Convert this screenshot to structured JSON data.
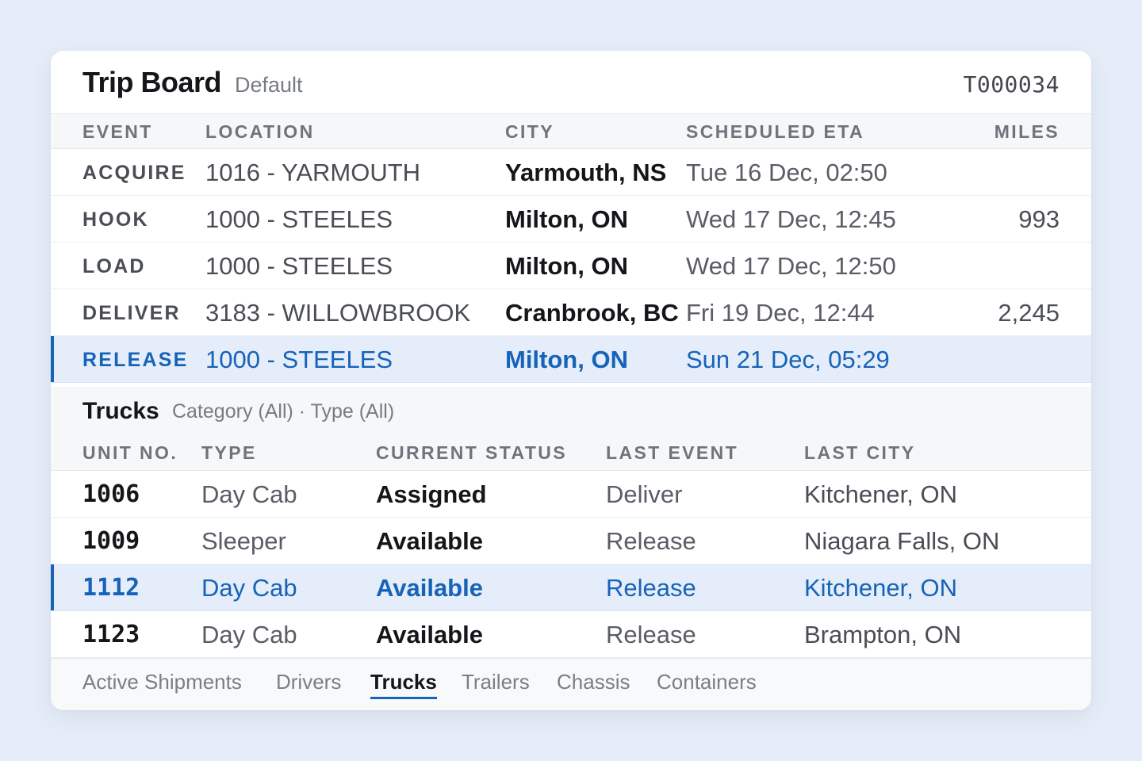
{
  "header": {
    "title": "Trip Board",
    "subtitle": "Default",
    "trip_id": "T000034"
  },
  "trip_table": {
    "columns": [
      "EVENT",
      "LOCATION",
      "CITY",
      "SCHEDULED ETA",
      "MILES"
    ],
    "rows": [
      {
        "event": "ACQUIRE",
        "location": "1016 - YARMOUTH",
        "city": "Yarmouth, NS",
        "eta": "Tue 16 Dec, 02:50",
        "miles": ""
      },
      {
        "event": "HOOK",
        "location": "1000 - STEELES",
        "city": "Milton, ON",
        "eta": "Wed 17 Dec, 12:45",
        "miles": "993"
      },
      {
        "event": "LOAD",
        "location": "1000 - STEELES",
        "city": "Milton, ON",
        "eta": "Wed 17 Dec, 12:50",
        "miles": ""
      },
      {
        "event": "DELIVER",
        "location": "3183 - WILLOWBROOK",
        "city": "Cranbrook, BC",
        "eta": "Fri 19 Dec, 12:44",
        "miles": "2,245"
      },
      {
        "event": "RELEASE",
        "location": "1000 - STEELES",
        "city": "Milton, ON",
        "eta": "Sun 21 Dec, 05:29",
        "miles": ""
      }
    ],
    "selected_row": "RELEASE"
  },
  "trucks": {
    "title": "Trucks",
    "filter": "Category (All) · Type (All)",
    "columns": [
      "UNIT NO.",
      "TYPE",
      "CURRENT STATUS",
      "LAST EVENT",
      "LAST CITY"
    ],
    "rows": [
      {
        "unit": "1006",
        "type": "Day Cab",
        "status": "Assigned",
        "last_event": "Deliver",
        "last_city": "Kitchener, ON"
      },
      {
        "unit": "1009",
        "type": "Sleeper",
        "status": "Available",
        "last_event": "Release",
        "last_city": "Niagara Falls, ON"
      },
      {
        "unit": "1112",
        "type": "Day Cab",
        "status": "Available",
        "last_event": "Release",
        "last_city": "Kitchener, ON"
      },
      {
        "unit": "1123",
        "type": "Day Cab",
        "status": "Available",
        "last_event": "Release",
        "last_city": "Brampton, ON"
      }
    ],
    "selected_unit": "1112"
  },
  "tabs": {
    "items": [
      "Active Shipments",
      "Drivers",
      "Trucks",
      "Trailers",
      "Chassis",
      "Containers"
    ],
    "active": "Trucks"
  },
  "colors": {
    "accent": "#1663b8",
    "background": "#e6edf8",
    "selected_row": "#e4edf9"
  }
}
